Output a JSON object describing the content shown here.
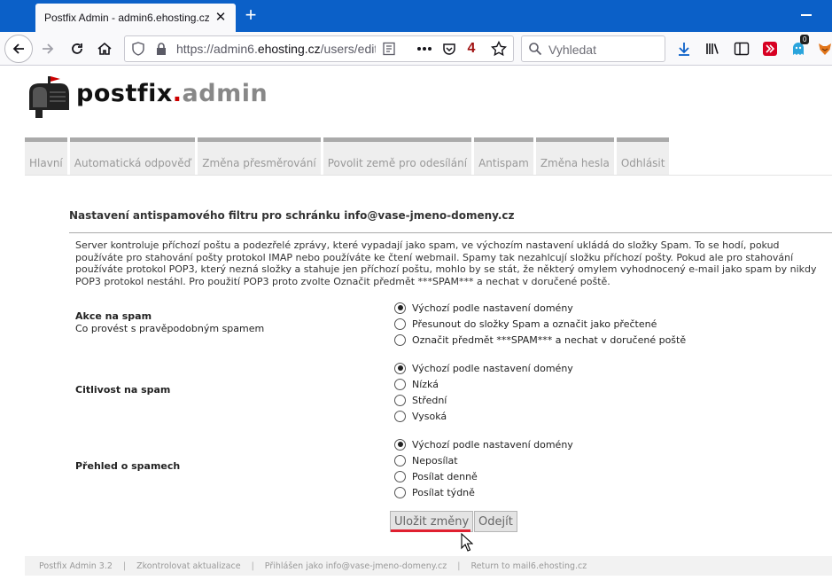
{
  "browser": {
    "tab_title": "Postfix Admin - admin6.ehosting.cz",
    "tab_close": "✕",
    "new_tab": "+",
    "url_prefix": "https://admin6.",
    "url_host": "ehosting.cz",
    "url_suffix": "/users/edit",
    "pocket_count": "4",
    "search_placeholder": "Vyhledat",
    "extension_badge": "0",
    "accent": "#0b60c8"
  },
  "logo": {
    "part1": "postfix",
    "dot": ".",
    "part2": "admin",
    "icon": "mailbox-icon"
  },
  "menu": {
    "items": [
      {
        "label": "Hlavní"
      },
      {
        "label": "Automatická odpověď"
      },
      {
        "label": "Změna přesměrování"
      },
      {
        "label": "Povolit země pro odesílání"
      },
      {
        "label": "Antispam"
      },
      {
        "label": "Změna hesla"
      },
      {
        "label": "Odhlásit"
      }
    ]
  },
  "form": {
    "title": "Nastavení antispamového filtru pro schránku info@vase-jmeno-domeny.cz",
    "intro": "Server kontroluje příchozí poštu a podezřelé zprávy, které vypadají jako spam, ve výchozím nastavení ukládá do složky Spam. To se hodí, pokud používáte pro stahování pošty protokol IMAP nebo používáte ke čtení webmail. Spamy tak nezahlcují složku příchozí pošty. Pokud ale pro stahování používáte protokol POP3, který nezná složky a stahuje jen příchozí poštu, mohlo by se stát, že některý omylem vyhodnocený e-mail jako spam by nikdy POP3 protokol nestáhl. Pro použití POP3 proto zvolte Označit předmět ***SPAM*** a nechat v doručené poště.",
    "spam_action": {
      "label": "Akce na spam",
      "description": "Co provést s pravěpodobným spamem",
      "options": [
        {
          "label": "Výchozí podle nastavení domény",
          "selected": true
        },
        {
          "label": "Přesunout do složky Spam a označit jako přečtené",
          "selected": false
        },
        {
          "label": "Označit předmět ***SPAM*** a nechat v doručené poště",
          "selected": false
        }
      ]
    },
    "sensitivity": {
      "label": "Citlivost na spam",
      "options": [
        {
          "label": "Výchozí podle nastavení domény",
          "selected": true
        },
        {
          "label": "Nízká",
          "selected": false
        },
        {
          "label": "Střední",
          "selected": false
        },
        {
          "label": "Vysoká",
          "selected": false
        }
      ]
    },
    "report": {
      "label": "Přehled o spamech",
      "options": [
        {
          "label": "Výchozí podle nastavení domény",
          "selected": true
        },
        {
          "label": "Neposílat",
          "selected": false
        },
        {
          "label": "Posílat denně",
          "selected": false
        },
        {
          "label": "Posílat týdně",
          "selected": false
        }
      ]
    },
    "save_label": "Uložit změny",
    "leave_label": "Odejít"
  },
  "footer": {
    "version": "Postfix Admin 3.2",
    "check_updates": "Zkontrolovat aktualizace",
    "logged_in": "Přihlášen jako info@vase-jmeno-domeny.cz",
    "return_to": "Return to mail6.ehosting.cz"
  }
}
